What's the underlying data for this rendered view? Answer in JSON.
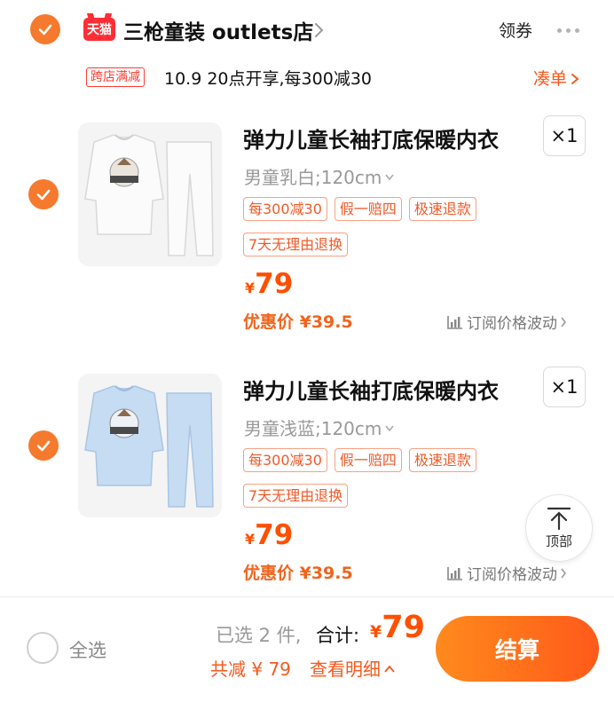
{
  "colors": {
    "accent": "#f57a2e",
    "price": "#ff4f00",
    "tmall_red": "#ff2e36"
  },
  "shop": {
    "logo_text": "天猫",
    "name": "三枪童装 outlets店",
    "coupon_label": "领券"
  },
  "promo": {
    "tag": "跨店满减",
    "text": "10.9 20点开享,每300减30",
    "link": "凑单"
  },
  "items": [
    {
      "title": "弹力儿童长袖打底保暖内衣",
      "sku": "男童乳白;120cm",
      "qty": "×1",
      "tags": [
        "每300减30",
        "假一赔四",
        "极速退款",
        "7天无理由退换"
      ],
      "price_symbol": "¥",
      "price": "79",
      "deal": "优惠价 ¥39.5",
      "subscribe": "订阅价格波动",
      "color_name": "white"
    },
    {
      "title": "弹力儿童长袖打底保暖内衣",
      "sku": "男童浅蓝;120cm",
      "qty": "×1",
      "tags": [
        "每300减30",
        "假一赔四",
        "极速退款",
        "7天无理由退换"
      ],
      "price_symbol": "¥",
      "price": "79",
      "deal": "优惠价 ¥39.5",
      "subscribe": "订阅价格波动",
      "color_name": "light-blue"
    }
  ],
  "back_to_top": "顶部",
  "footer": {
    "select_all": "全选",
    "selected_count": "已选 2 件,",
    "total_label": "合计:",
    "total_symbol": "¥",
    "total": "79",
    "saved": "共减 ¥ 79",
    "detail": "查看明细",
    "checkout": "结算"
  }
}
